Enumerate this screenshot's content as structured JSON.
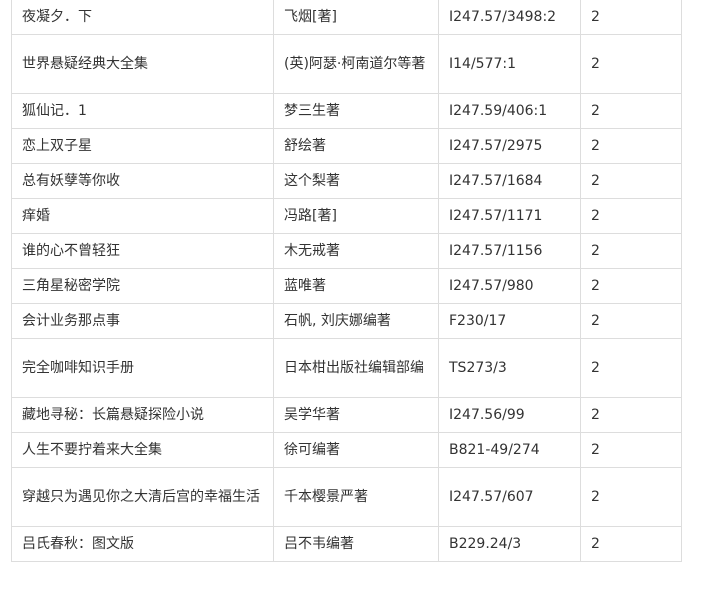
{
  "books": [
    {
      "title": "夜凝夕．下",
      "author": "飞烟[著]",
      "call_number": "I247.57/3498:2",
      "count": "2"
    },
    {
      "title": "世界悬疑经典大全集",
      "author": "(英)阿瑟·柯南道尔等著",
      "call_number": "I14/577:1",
      "count": "2"
    },
    {
      "title": "狐仙记．1",
      "author": "梦三生著",
      "call_number": "I247.59/406:1",
      "count": "2"
    },
    {
      "title": "恋上双子星",
      "author": "舒绘著",
      "call_number": "I247.57/2975",
      "count": "2"
    },
    {
      "title": "总有妖孽等你收",
      "author": "这个梨著",
      "call_number": "I247.57/1684",
      "count": "2"
    },
    {
      "title": "痒婚",
      "author": "冯路[著]",
      "call_number": "I247.57/1171",
      "count": "2"
    },
    {
      "title": "谁的心不曾轻狂",
      "author": "木无戒著",
      "call_number": "I247.57/1156",
      "count": "2"
    },
    {
      "title": "三角星秘密学院",
      "author": "蓝唯著",
      "call_number": "I247.57/980",
      "count": "2"
    },
    {
      "title": "会计业务那点事",
      "author": "石帆, 刘庆娜编著",
      "call_number": "F230/17",
      "count": "2"
    },
    {
      "title": "完全咖啡知识手册",
      "author": "日本柑出版社编辑部编",
      "call_number": "TS273/3",
      "count": "2"
    },
    {
      "title": "藏地寻秘：长篇悬疑探险小说",
      "author": "吴学华著",
      "call_number": "I247.56/99",
      "count": "2"
    },
    {
      "title": "人生不要拧着来大全集",
      "author": "徐可编著",
      "call_number": "B821-49/274",
      "count": "2"
    },
    {
      "title": "穿越只为遇见你之大清后宫的幸福生活",
      "author": "千本樱景严著",
      "call_number": "I247.57/607",
      "count": "2"
    },
    {
      "title": "吕氏春秋：图文版",
      "author": "吕不韦编著",
      "call_number": "B229.24/3",
      "count": "2"
    }
  ]
}
